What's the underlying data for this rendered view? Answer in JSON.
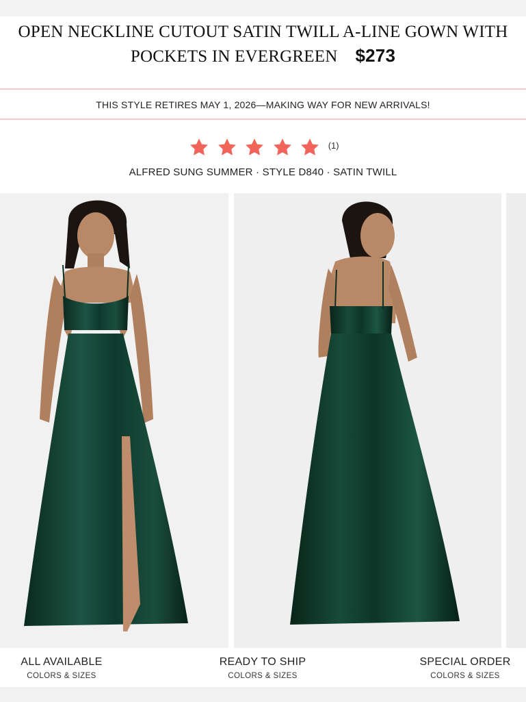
{
  "product": {
    "title_line1": "OPEN NECKLINE CUTOUT SATIN TWILL A-LINE GOWN WITH",
    "title_line2": "POCKETS IN EVERGREEN",
    "price": "$273"
  },
  "notice": "THIS STYLE RETIRES MAY 1, 2026—MAKING WAY FOR NEW ARRIVALS!",
  "rating": {
    "stars": 5,
    "count": "(1)",
    "star_color": "#f0645a"
  },
  "meta": "ALFRED SUNG SUMMER · STYLE D840 · SATIN TWILL",
  "colors": {
    "accent_border": "#f3c9cf",
    "gown": "#0f3a2c"
  },
  "filters": [
    {
      "label": "ALL AVAILABLE",
      "sub": "COLORS & SIZES"
    },
    {
      "label": "READY TO SHIP",
      "sub": "COLORS & SIZES"
    },
    {
      "label": "SPECIAL ORDER",
      "sub": "COLORS & SIZES"
    }
  ]
}
